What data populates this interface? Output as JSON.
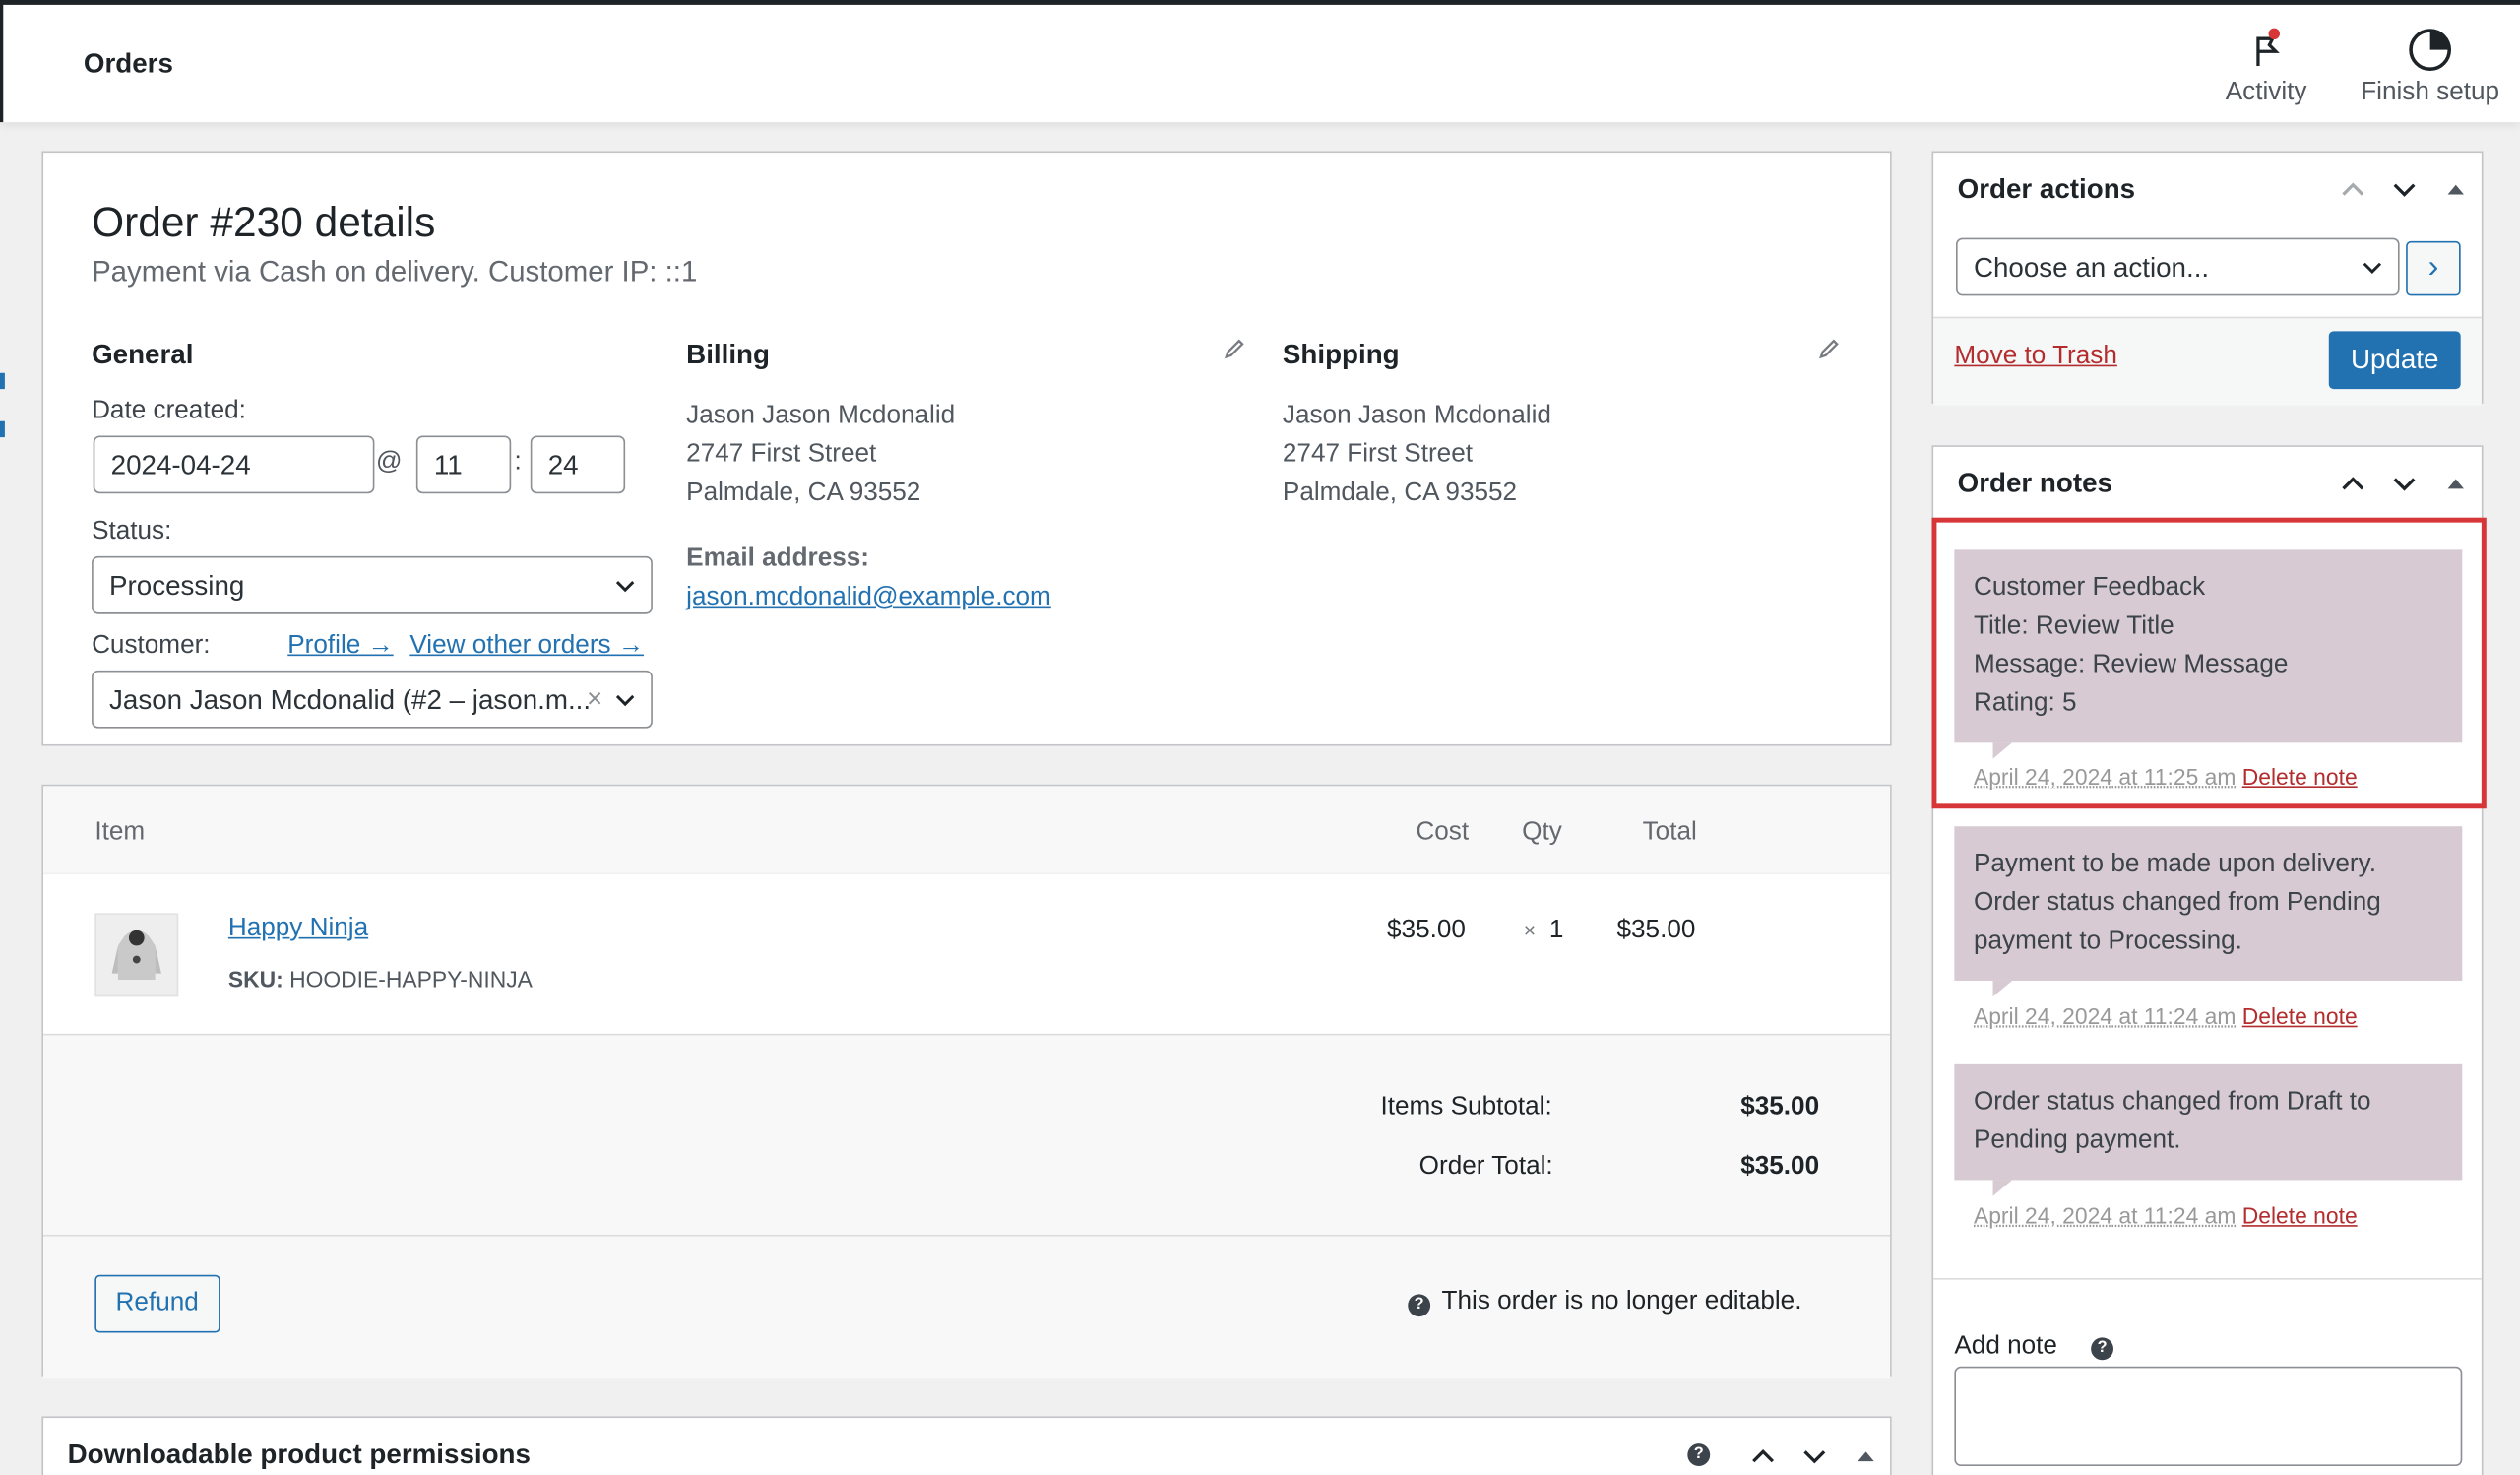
{
  "topbar": {
    "title": "Orders",
    "activity_label": "Activity",
    "finish_setup_label": "Finish setup"
  },
  "order": {
    "heading": "Order #230 details",
    "subtitle": "Payment via Cash on delivery. Customer IP: ::1",
    "general": {
      "heading": "General",
      "date_label": "Date created:",
      "date_value": "2024-04-24",
      "at_sep": "@",
      "hour_value": "11",
      "time_sep": ":",
      "minute_value": "24",
      "status_label": "Status:",
      "status_value": "Processing",
      "customer_label": "Customer:",
      "profile_link": "Profile →",
      "other_orders_link": "View other orders →",
      "customer_value": "Jason Jason Mcdonalid (#2 – jason.m...",
      "clear_glyph": "×"
    },
    "billing": {
      "heading": "Billing",
      "name": "Jason Jason Mcdonalid",
      "street": "2747 First Street",
      "city": "Palmdale, CA 93552",
      "email_label": "Email address:",
      "email": "jason.mcdonalid@example.com"
    },
    "shipping": {
      "heading": "Shipping",
      "name": "Jason Jason Mcdonalid",
      "street": "2747 First Street",
      "city": "Palmdale, CA 93552"
    }
  },
  "items": {
    "headers": {
      "item": "Item",
      "cost": "Cost",
      "qty": "Qty",
      "total": "Total"
    },
    "rows": [
      {
        "name": "Happy Ninja",
        "sku_label": "SKU:",
        "sku": "HOODIE-HAPPY-NINJA",
        "cost": "$35.00",
        "qty_prefix": "×",
        "qty": "1",
        "total": "$35.00"
      }
    ],
    "subtotal_label": "Items Subtotal:",
    "subtotal_value": "$35.00",
    "total_label": "Order Total:",
    "total_value": "$35.00",
    "refund_label": "Refund",
    "not_editable": "This order is no longer editable.",
    "help_glyph": "?"
  },
  "downloads": {
    "heading": "Downloadable product permissions"
  },
  "order_actions": {
    "heading": "Order actions",
    "select_value": "Choose an action...",
    "go_glyph": "›",
    "trash_label": "Move to Trash",
    "update_label": "Update"
  },
  "order_notes": {
    "heading": "Order notes",
    "notes": [
      {
        "lines": [
          "Customer Feedback",
          "Title: Review Title",
          "Message: Review Message",
          "Rating: 5"
        ],
        "date": "April 24, 2024 at 11:25 am",
        "delete": "Delete note"
      },
      {
        "lines": [
          "Payment to be made upon delivery.",
          "Order status changed from Pending",
          "payment to Processing."
        ],
        "date": "April 24, 2024 at 11:24 am",
        "delete": "Delete note"
      },
      {
        "lines": [
          "Order status changed from Draft to",
          "Pending payment."
        ],
        "date": "April 24, 2024 at 11:24 am",
        "delete": "Delete note"
      }
    ],
    "add_note_label": "Add note",
    "help_glyph": "?"
  },
  "colors": {
    "primary": "#2271b1",
    "note_bg": "#d7cad2",
    "highlight": "#d63638",
    "danger": "#b32d2e"
  }
}
